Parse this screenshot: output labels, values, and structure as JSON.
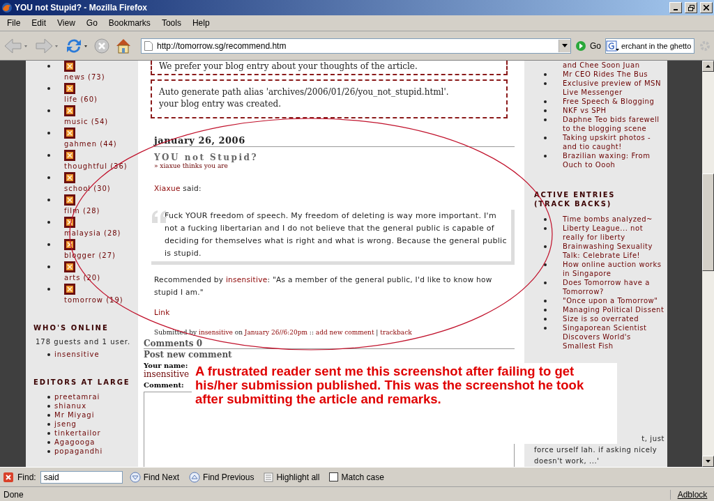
{
  "window": {
    "title": "YOU not Stupid? - Mozilla Firefox"
  },
  "menu": [
    "File",
    "Edit",
    "View",
    "Go",
    "Bookmarks",
    "Tools",
    "Help"
  ],
  "toolbar": {
    "url": "http://tomorrow.sg/recommend.htm",
    "go": "Go",
    "search": "erchant in the ghetto"
  },
  "left_sidebar": {
    "categories": [
      "news (73)",
      "life (60)",
      "music (54)",
      "gahmen (44)",
      "thoughtful (36)",
      "school (30)",
      "film (28)",
      "malaysia (28)",
      "blogger (27)",
      "arts (20)",
      "tomorrow (19)"
    ],
    "whos_online": {
      "title": "WHO'S ONLINE",
      "text": "178 guests and 1 user.",
      "users": [
        "insensitive"
      ]
    },
    "editors": {
      "title": "EDITORS AT LARGE",
      "items": [
        "preetamrai",
        "shianux",
        "Mr Miyagi",
        "jseng",
        "tinkertailor",
        "Agagooga",
        "popagandhi"
      ]
    }
  },
  "main": {
    "message": "We prefer your blog entry about your thoughts of the article.",
    "status": [
      "Auto generate path alias 'archives/2006/01/26/you_not_stupid.html'.",
      "your blog entry was created."
    ],
    "date": "january 26, 2006",
    "title": "YOU not Stupid?",
    "subtitle": "» xiaxue thinks you are",
    "said": {
      "author": "Xiaxue",
      "text": " said:"
    },
    "quote": "Fuck YOUR freedom of speech. My freedom of deleting is way more important. I'm not a fucking libertarian and I do not believe that the general public is capable of deciding for themselves what is right and what is wrong. Because the general public is stupid.",
    "recommended": {
      "prefix": "Recommended by ",
      "user": "insensitive",
      "text": ": \"As a member of the general public, I'd like to know how stupid I am.\""
    },
    "link": "Link",
    "submitted": [
      {
        "kind": "text",
        "text": "Submitted by "
      },
      {
        "kind": "link",
        "text": "insensitive"
      },
      {
        "kind": "text",
        "text": " on "
      },
      {
        "kind": "link",
        "text": "January 26//6:20pm"
      },
      {
        "kind": "text",
        "text": " :: "
      },
      {
        "kind": "link",
        "text": "add new comment"
      },
      {
        "kind": "text",
        "text": " | "
      },
      {
        "kind": "link",
        "text": "trackback"
      }
    ],
    "comments": "Comments 0",
    "post_title": "Post new comment",
    "name_label": "Your name:",
    "name_value": "insensitive",
    "comment_label": "Comment:"
  },
  "right_sidebar": {
    "continued": "and Chee Soon Juan",
    "recent": [
      "Mr CEO Rides The Bus",
      "Exclusive preview of MSN Live Messenger",
      "Free Speech & Blogging",
      "NKF vs SPH",
      "Daphne Teo bids farewell to the blogging scene",
      "Taking upskirt photos - and tio caught!",
      "Brazilian waxing: From Ouch to Oooh"
    ],
    "active_title": "ACTIVE ENTRIES (TRACK BACKS)",
    "active": [
      "Time bombs analyzed~",
      "Liberty League... not really for liberty",
      "Brainwashing Sexuality Talk: Celebrate Life!",
      "How online auction works in Singapore",
      "Does Tomorrow have a Tomorrow?",
      "\"Once upon a Tomorrow\"",
      "Managing Political Dissent",
      "Size is so overrated",
      "Singaporean Scientist Discovers World's Smallest Fish"
    ],
    "bottom_lines": [
      "t, just",
      "force urself lah. if asking nicely doesn't work, ...'"
    ]
  },
  "annotation": "A frustrated reader sent me this screenshot after failing to get his/her submission published. This was the screenshot he took after submitting the article and remarks.",
  "find_bar": {
    "label": "Find:",
    "value": "said",
    "buttons": [
      "Find Next",
      "Find Previous",
      "Highlight all"
    ],
    "match_case": {
      "label": "Match case",
      "checked": false
    }
  },
  "status_bar": {
    "text": "Done",
    "adblock": "Adblock"
  }
}
